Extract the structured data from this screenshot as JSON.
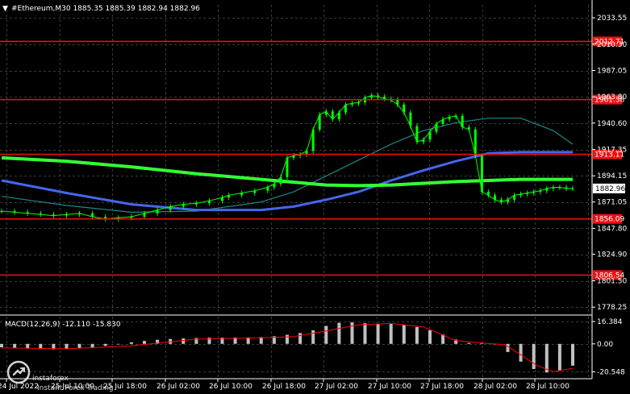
{
  "header": {
    "symbol_line": "#Ethereum,M30  1885.35 1885.39 1882.94 1882.96"
  },
  "colors": {
    "background": "#000000",
    "grid": "#3a3a3a",
    "candles": "#00ff00",
    "ma_slow": "#33ff33",
    "ma_mid": "#4466ee",
    "ma_fast": "#1a8a8a",
    "level_lines": "#ee1111",
    "macd_hist": "#c0c0c0",
    "macd_signal": "#ff0000"
  },
  "watermark": {
    "brand": "instaforex",
    "tagline": "Instant Forex Trading"
  },
  "chart_data": [
    {
      "type": "line",
      "title": "#Ethereum,M30",
      "ylim": [
        1772.0,
        2045.0
      ],
      "y_ticks": [
        "2033.55",
        "2010.30",
        "1987.05",
        "1963.80",
        "1940.60",
        "1917.35",
        "1894.15",
        "1871.05",
        "1847.80",
        "1824.90",
        "1801.50",
        "1778.25"
      ],
      "x_tick_labels": [
        "24 Jul 2022",
        "25 Jul 10:00",
        "25 Jul 18:00",
        "26 Jul 02:00",
        "26 Jul 10:00",
        "26 Jul 18:00",
        "27 Jul 02:00",
        "27 Jul 10:00",
        "27 Jul 18:00",
        "28 Jul 02:00",
        "28 Jul 10:00"
      ],
      "current_price": "1882.96",
      "levels": [
        {
          "label": "2012.71",
          "value": 2012.71
        },
        {
          "label": "1961.38",
          "value": 1961.38
        },
        {
          "label": "1913.11",
          "value": 1913.11
        },
        {
          "label": "1856.09",
          "value": 1856.09
        },
        {
          "label": "1806.54",
          "value": 1806.54
        }
      ],
      "series": [
        {
          "role": "price",
          "x": [
            0,
            4,
            8,
            12,
            16,
            20,
            24,
            28,
            32,
            36,
            40,
            44,
            48,
            52,
            56,
            60,
            64,
            68,
            70,
            74,
            78,
            82,
            84,
            86,
            88,
            90,
            92,
            94,
            96,
            98,
            100,
            102,
            104,
            106,
            108,
            110,
            112,
            114,
            116,
            118,
            120,
            122,
            124,
            126,
            128,
            130,
            132,
            134,
            136,
            138,
            140,
            142,
            144,
            146,
            148,
            150,
            152,
            154,
            156,
            158,
            160,
            162,
            164,
            166,
            168,
            170,
            172,
            174,
            176
          ],
          "values": [
            1863,
            1862,
            1861,
            1860,
            1859,
            1860,
            1861,
            1858,
            1856,
            1857,
            1858,
            1861,
            1864,
            1867,
            1869,
            1870,
            1872,
            1875,
            1877,
            1879,
            1881,
            1884,
            1887,
            1893,
            1910,
            1912,
            1913,
            1916,
            1935,
            1948,
            1951,
            1944,
            1950,
            1957,
            1958,
            1959,
            1963,
            1965,
            1964,
            1962,
            1961,
            1957,
            1950,
            1938,
            1924,
            1926,
            1933,
            1940,
            1944,
            1946,
            1947,
            1937,
            1935,
            1912,
            1880,
            1877,
            1873,
            1871,
            1873,
            1877,
            1878,
            1879,
            1880,
            1881,
            1883,
            1884,
            1884,
            1883,
            1883
          ]
        },
        {
          "role": "ma_slow",
          "x": [
            0,
            20,
            40,
            60,
            80,
            90,
            100,
            110,
            120,
            130,
            140,
            150,
            160,
            170,
            176
          ],
          "values": [
            1910,
            1907,
            1902,
            1896,
            1891,
            1888.5,
            1886,
            1885.5,
            1886,
            1887.5,
            1889,
            1890,
            1891,
            1891,
            1891
          ]
        },
        {
          "role": "ma_mid",
          "x": [
            0,
            20,
            40,
            60,
            80,
            90,
            100,
            110,
            120,
            130,
            140,
            150,
            160,
            170,
            176
          ],
          "values": [
            1890,
            1879,
            1869,
            1864,
            1864,
            1867,
            1873,
            1880,
            1890,
            1899,
            1907,
            1914,
            1915,
            1915,
            1915
          ]
        },
        {
          "role": "ma_fast",
          "x": [
            0,
            20,
            40,
            60,
            80,
            90,
            100,
            110,
            120,
            130,
            140,
            150,
            160,
            170,
            176
          ],
          "values": [
            1876,
            1868,
            1862,
            1863,
            1871,
            1880,
            1894,
            1908,
            1922,
            1934,
            1941,
            1945,
            1945,
            1934,
            1922
          ]
        }
      ]
    },
    {
      "type": "bar",
      "title": "MACD(12,26,9) -12.110 -15.830",
      "ylim": [
        -25,
        20
      ],
      "y_ticks": [
        "16.384",
        "0.00",
        "-20.548"
      ],
      "series": [
        {
          "name": "MACD(12,26,9)",
          "x": [
            0,
            4,
            8,
            12,
            16,
            20,
            24,
            28,
            32,
            36,
            40,
            44,
            48,
            52,
            56,
            60,
            64,
            68,
            72,
            76,
            80,
            84,
            88,
            92,
            96,
            100,
            104,
            108,
            112,
            116,
            120,
            124,
            128,
            132,
            136,
            140,
            144,
            148,
            152,
            156,
            160,
            164,
            168,
            172,
            176
          ],
          "values": [
            -2.5,
            -3,
            -3.5,
            -3.8,
            -4,
            -3.8,
            -3.2,
            -2.5,
            -1.5,
            -0.3,
            1.2,
            2.2,
            3,
            3.6,
            4,
            4.3,
            4.6,
            4.6,
            4.7,
            4.8,
            5,
            5.6,
            6.6,
            8,
            10,
            13.2,
            15.5,
            15.8,
            15.2,
            14.6,
            14.6,
            14,
            12.4,
            10,
            7,
            3.2,
            0.7,
            0.4,
            -0.5,
            -6,
            -13,
            -18.5,
            -21,
            -19.5,
            -16
          ]
        },
        {
          "name": "signal",
          "x": [
            0,
            20,
            40,
            60,
            80,
            90,
            100,
            110,
            120,
            130,
            140,
            150,
            155,
            160,
            165,
            170,
            176
          ],
          "values": [
            -3,
            -3.6,
            -1.5,
            3.5,
            4.5,
            5.3,
            9.5,
            14,
            15,
            12.5,
            2.5,
            0.2,
            -0.5,
            -8,
            -16,
            -20.5,
            -18
          ]
        }
      ]
    }
  ]
}
